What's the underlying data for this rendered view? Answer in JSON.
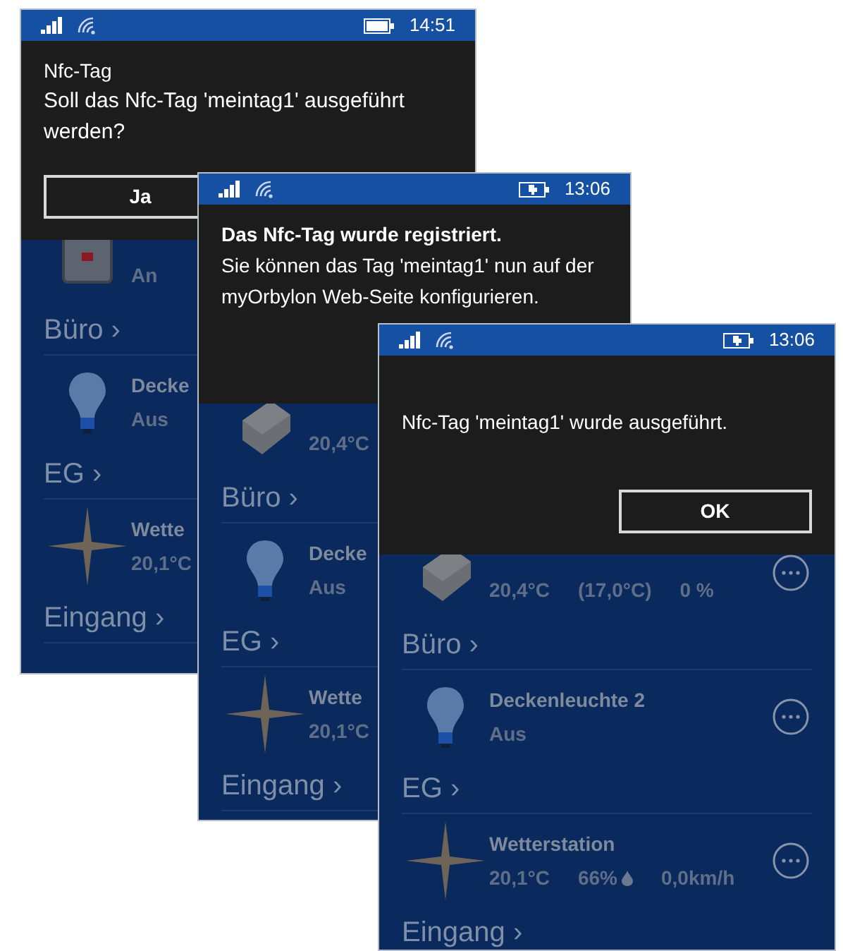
{
  "screens": [
    {
      "status": {
        "time": "14:51",
        "charging": false
      },
      "dialog": {
        "title": "Nfc-Tag",
        "title_bold": false,
        "message": "Soll das Nfc-Tag 'meintag1' ausgeführt werden?",
        "buttons": [
          {
            "label": "Ja"
          }
        ]
      },
      "list": [
        {
          "kind": "switch",
          "details": [
            "An"
          ]
        },
        {
          "kind": "section",
          "label": "Büro ›"
        },
        {
          "kind": "lamp",
          "name": "Decke",
          "details": [
            "Aus"
          ]
        },
        {
          "kind": "section",
          "label": "EG ›"
        },
        {
          "kind": "weather",
          "name": "Wette",
          "details": [
            "20,1°C"
          ]
        },
        {
          "kind": "section",
          "label": "Eingang ›"
        }
      ]
    },
    {
      "status": {
        "time": "13:06",
        "charging": true
      },
      "dialog": {
        "title": "Das Nfc-Tag wurde registriert.",
        "title_bold": true,
        "message": "Sie können das Tag 'meintag1' nun auf der myOrbylon Web-Seite konfigurieren."
      },
      "list": [
        {
          "kind": "thermostat",
          "details": [
            "20,4°C"
          ]
        },
        {
          "kind": "section",
          "label": "Büro ›"
        },
        {
          "kind": "lamp",
          "name": "Decke",
          "details": [
            "Aus"
          ]
        },
        {
          "kind": "section",
          "label": "EG ›"
        },
        {
          "kind": "weather",
          "name": "Wette",
          "details": [
            "20,1°C"
          ]
        },
        {
          "kind": "section",
          "label": "Eingang ›"
        }
      ]
    },
    {
      "status": {
        "time": "13:06",
        "charging": true
      },
      "dialog": {
        "message": "Nfc-Tag 'meintag1' wurde ausgeführt.",
        "buttons": [
          {
            "label": "OK"
          }
        ]
      },
      "list": [
        {
          "kind": "thermostat",
          "details": [
            "20,4°C",
            "(17,0°C)",
            "0 %"
          ],
          "more": true
        },
        {
          "kind": "section",
          "label": "Büro ›"
        },
        {
          "kind": "lamp",
          "name": "Deckenleuchte 2",
          "details": [
            "Aus"
          ],
          "more": true
        },
        {
          "kind": "section",
          "label": "EG ›"
        },
        {
          "kind": "weather",
          "name": "Wetterstation",
          "details": [
            "20,1°C",
            "66%",
            "0,0km/h"
          ],
          "more": true
        },
        {
          "kind": "section",
          "label": "Eingang ›"
        }
      ]
    }
  ]
}
